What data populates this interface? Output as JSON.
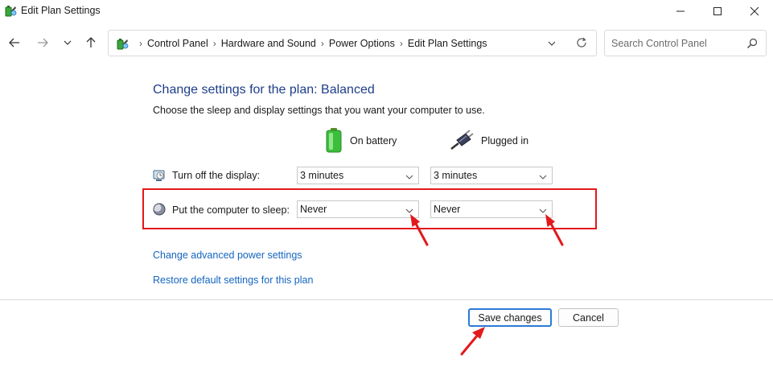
{
  "window": {
    "title": "Edit Plan Settings"
  },
  "address": {
    "breadcrumbs": [
      "Control Panel",
      "Hardware and Sound",
      "Power Options",
      "Edit Plan Settings"
    ],
    "search_placeholder": "Search Control Panel"
  },
  "content": {
    "title": "Change settings for the plan: Balanced",
    "subtitle": "Choose the sleep and display settings that you want your computer to use.",
    "columns": {
      "battery": "On battery",
      "plugged": "Plugged in"
    },
    "settings": [
      {
        "label": "Turn off the display:",
        "battery": "3 minutes",
        "plugged": "3 minutes"
      },
      {
        "label": "Put the computer to sleep:",
        "battery": "Never",
        "plugged": "Never"
      }
    ],
    "links": {
      "advanced": "Change advanced power settings",
      "restore": "Restore default settings for this plan"
    }
  },
  "buttons": {
    "save": "Save changes",
    "cancel": "Cancel"
  },
  "colors": {
    "title": "#1e3e8a",
    "link": "#1565c0",
    "highlight": "#e3191c",
    "primary_border": "#2b7bd6"
  }
}
